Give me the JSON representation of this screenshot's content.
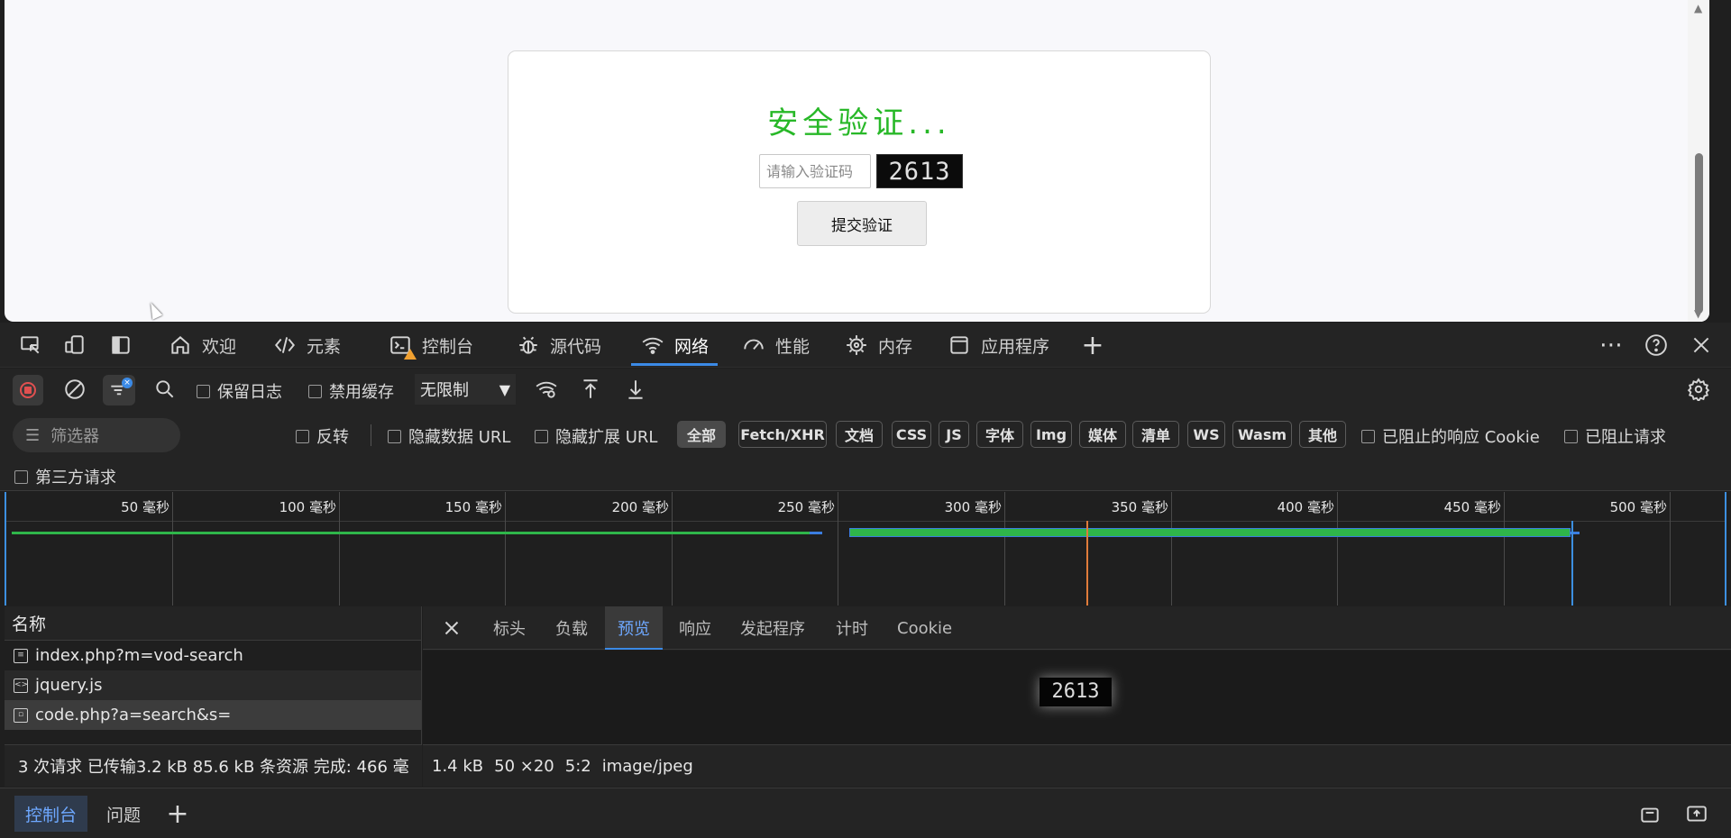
{
  "page": {
    "title": "安全验证...",
    "input_placeholder": "请输入验证码",
    "captcha_text": "2613",
    "submit_label": "提交验证"
  },
  "devtools": {
    "tabs": [
      {
        "label": "欢迎",
        "icon": "home-icon"
      },
      {
        "label": "元素",
        "icon": "code-icon"
      },
      {
        "label": "控制台",
        "icon": "console-icon"
      },
      {
        "label": "源代码",
        "icon": "bug-icon"
      },
      {
        "label": "网络",
        "icon": "wifi-icon"
      },
      {
        "label": "性能",
        "icon": "gauge-icon"
      },
      {
        "label": "内存",
        "icon": "chip-icon"
      },
      {
        "label": "应用程序",
        "icon": "window-icon"
      }
    ],
    "active_tab": "网络",
    "toolbar": {
      "preserve_log": "保留日志",
      "disable_cache": "禁用缓存",
      "throttle": "无限制"
    },
    "filter": {
      "placeholder": "筛选器",
      "invert": "反转",
      "hide_data_url": "隐藏数据 URL",
      "hide_ext_url": "隐藏扩展 URL",
      "types": [
        "全部",
        "Fetch/XHR",
        "文档",
        "CSS",
        "JS",
        "字体",
        "Img",
        "媒体",
        "清单",
        "WS",
        "Wasm",
        "其他"
      ],
      "blocked_cookies": "已阻止的响应 Cookie",
      "blocked_requests": "已阻止请求",
      "third_party": "第三方请求"
    },
    "timeline": {
      "ticks": [
        "50 毫秒",
        "100 毫秒",
        "150 毫秒",
        "200 毫秒",
        "250 毫秒",
        "300 毫秒",
        "350 毫秒",
        "400 毫秒",
        "450 毫秒",
        "500 毫秒"
      ]
    },
    "requests": {
      "header": "名称",
      "rows": [
        "index.php?m=vod-search",
        "jquery.js",
        "code.php?a=search&s="
      ]
    },
    "detail_tabs": [
      "标头",
      "负载",
      "预览",
      "响应",
      "发起程序",
      "计时",
      "Cookie"
    ],
    "active_detail_tab": "预览",
    "preview_image_text": "2613",
    "summary": "3 次请求  已传输3.2 kB  85.6 kB 条资源  完成: 466 毫",
    "image_info": [
      "1.4 kB",
      "50 ×20",
      "5:2",
      "image/jpeg"
    ],
    "drawer_tabs": [
      "控制台",
      "问题"
    ]
  }
}
